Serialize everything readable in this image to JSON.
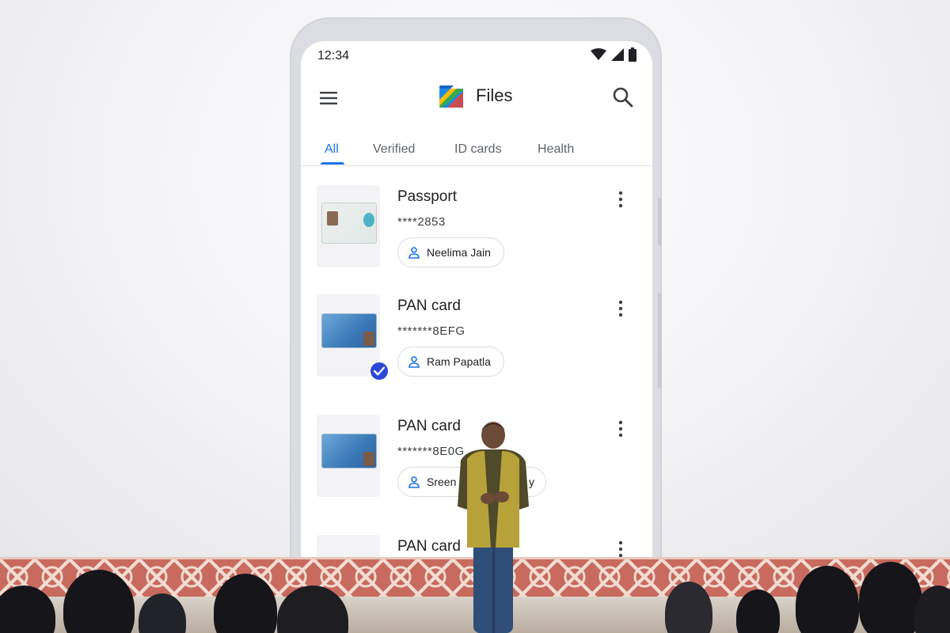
{
  "status_bar": {
    "time": "12:34"
  },
  "app_bar": {
    "title": "Files"
  },
  "tabs": [
    {
      "label": "All",
      "active": true
    },
    {
      "label": "Verified",
      "active": false
    },
    {
      "label": "ID cards",
      "active": false
    },
    {
      "label": "Health",
      "active": false
    }
  ],
  "documents": [
    {
      "title": "Passport",
      "number": "****2853",
      "owner": "Neelima Jain",
      "verified": false
    },
    {
      "title": "PAN card",
      "number": "*******8EFG",
      "owner": "Ram Papatla",
      "verified": true
    },
    {
      "title": "PAN card",
      "number": "*******8E0G",
      "owner": "Sreen",
      "owner_tail": "y",
      "verified": false
    },
    {
      "title": "PAN card"
    }
  ],
  "colors": {
    "accent": "#1a73e8",
    "verified_badge": "#2a47d9",
    "stage_rail": "#c86a5e"
  },
  "icons": [
    "menu-icon",
    "files-logo-icon",
    "search-icon",
    "wifi-icon",
    "signal-icon",
    "battery-icon",
    "person-icon",
    "more-vert-icon",
    "check-icon"
  ]
}
